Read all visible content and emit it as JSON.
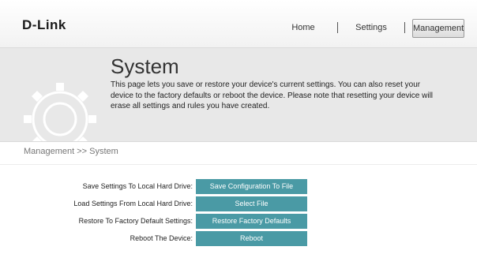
{
  "header": {
    "logo": "D-Link",
    "nav": [
      "Home",
      "Settings",
      "Management"
    ],
    "active_nav": "Management"
  },
  "banner": {
    "title": "System",
    "description": "This page lets you save or restore your device's current settings. You can also reset your device to the factory defaults or reboot the device. Please note that resetting your device will erase all settings and rules you have created.",
    "icon": "gear-icon"
  },
  "breadcrumb": "Management >> System",
  "rows": [
    {
      "label": "Save Settings To Local Hard Drive:",
      "button": "Save Configuration To File"
    },
    {
      "label": "Load Settings From Local Hard Drive:",
      "button": "Select File"
    },
    {
      "label": "Restore To Factory Default Settings:",
      "button": "Restore Factory Defaults"
    },
    {
      "label": "Reboot The Device:",
      "button": "Reboot"
    }
  ],
  "colors": {
    "button": "#4a9aa5",
    "banner": "#e8e8e8"
  }
}
